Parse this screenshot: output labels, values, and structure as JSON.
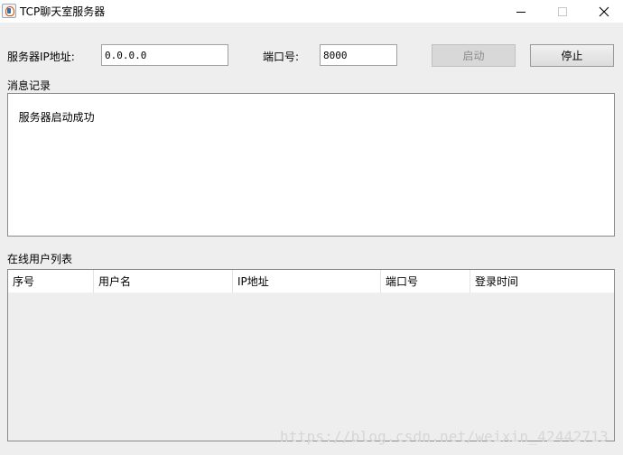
{
  "window": {
    "title": "TCP聊天室服务器",
    "controls": [
      "minimize-icon",
      "maximize-icon",
      "close-icon"
    ]
  },
  "config": {
    "server_ip_label": "服务器IP地址:",
    "server_ip_value": "0.0.0.0",
    "port_label": "端口号:",
    "port_value": "8000",
    "start_label": "启动",
    "start_enabled": false,
    "stop_label": "停止"
  },
  "log": {
    "heading": "消息记录",
    "content": "服务器启动成功"
  },
  "users": {
    "heading": "在线用户列表",
    "columns": [
      "序号",
      "用户名",
      "IP地址",
      "端口号",
      "登录时间"
    ],
    "rows": []
  },
  "watermark": "https://blog.csdn.net/weixin_42442713",
  "colors": {
    "background": "#eeeeee",
    "disabled_text": "#8c8c8c"
  }
}
